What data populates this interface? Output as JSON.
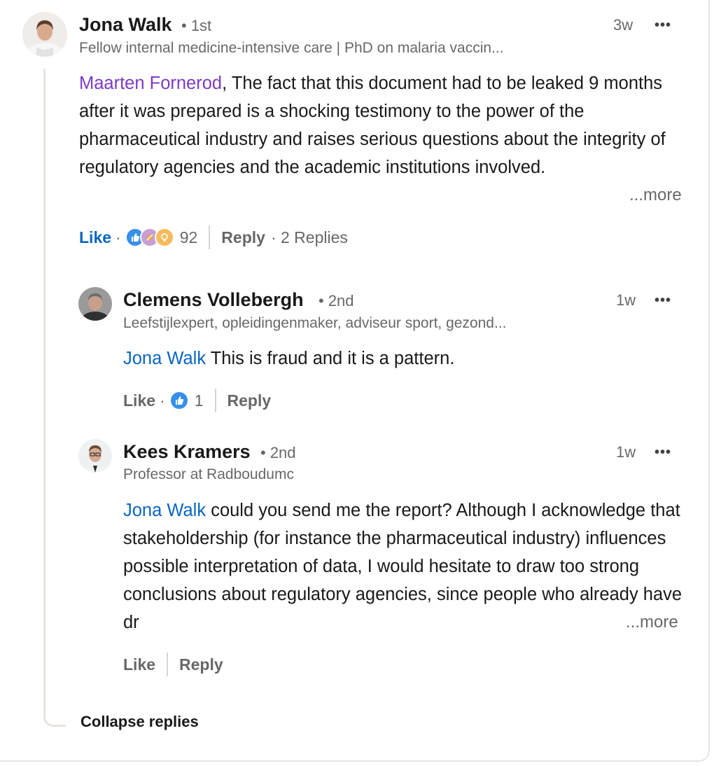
{
  "colors": {
    "mention_purple": "#7c3cc4",
    "mention_blue": "#0a66c2",
    "like_blue": "#0a66c2",
    "celebrate": "#c27dbb",
    "insight": "#f5bb5c"
  },
  "comments": [
    {
      "author": "Jona Walk",
      "degree": "• 1st",
      "headline": "Fellow internal medicine-intensive care | PhD on malaria vaccin...",
      "time": "3w",
      "menu": "•••",
      "mention": "Maarten Fornerod",
      "text": ", The fact that this document had to be leaked 9 months after it was prepared is a shocking testimony to the power of the pharmaceutical industry and raises serious questions about the integrity of regulatory agencies and the academic institutions involved.",
      "more": "...more",
      "like": "Like",
      "dot": "·",
      "reaction_icons": [
        "like-icon",
        "celebrate-icon",
        "insight-icon"
      ],
      "reaction_count": "92",
      "reply": "Reply",
      "replies": "· 2 Replies"
    },
    {
      "author": "Clemens Vollebergh",
      "degree": "• 2nd",
      "headline": "Leefstijlexpert, opleidingenmaker, adviseur sport, gezond...",
      "time": "1w",
      "menu": "•••",
      "mention": "Jona Walk",
      "text": " This is fraud and it is a pattern.",
      "like": "Like",
      "dot": "·",
      "reaction_icons": [
        "like-icon"
      ],
      "reaction_count": "1",
      "reply": "Reply"
    },
    {
      "author": "Kees Kramers",
      "degree": "• 2nd",
      "headline": "Professor at Radboudumc",
      "time": "1w",
      "menu": "•••",
      "mention": "Jona Walk",
      "text": " could you send me the report? Although I acknowledge that stakeholdership (for instance the pharmaceutical industry) influences possible interpretation of data, I would hesitate to draw too strong conclusions about regulatory agencies, since people who already have dr",
      "more": "...more",
      "like": "Like",
      "reply": "Reply"
    }
  ],
  "collapse_label": "Collapse replies"
}
